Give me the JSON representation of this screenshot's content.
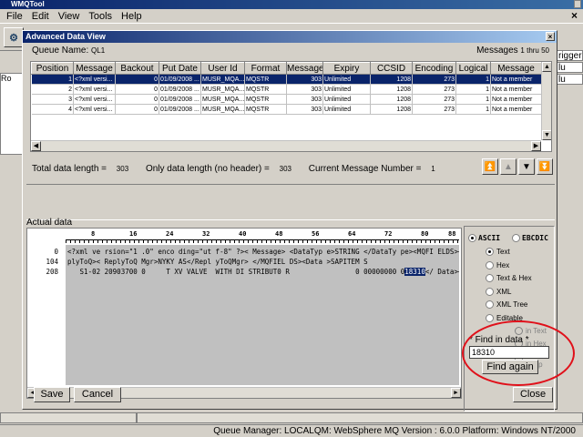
{
  "app": {
    "title": "WMQTool",
    "menu": [
      "File",
      "Edit",
      "View",
      "Tools",
      "Help"
    ]
  },
  "background": {
    "tree_label": "Ro",
    "right_labels": [
      "rigger",
      "lu",
      "lu"
    ],
    "status": "Queue Manager: LOCALQM: WebSphere MQ Version : 6.0.0 Platform: Windows NT/2000"
  },
  "dialog": {
    "title": "Advanced Data View",
    "queue_label": "Queue Name:",
    "queue_name": "QL1",
    "messages_label": "Messages",
    "messages_range": "1 thru 50"
  },
  "grid": {
    "columns": [
      "Position",
      "Message",
      "Backout",
      "Put Date",
      "User Id",
      "Format",
      "Message",
      "Expiry",
      "CCSID",
      "Encoding",
      "Logical",
      "Message"
    ],
    "rows": [
      [
        "1",
        "<?xml versi...",
        "0",
        "01/09/2008 ...",
        "MUSR_MQA...",
        "MQSTR",
        "303",
        "Unlimited",
        "1208",
        "273",
        "1",
        "Not a member"
      ],
      [
        "2",
        "<?xml versi...",
        "0",
        "01/09/2008 ...",
        "MUSR_MQA...",
        "MQSTR",
        "303",
        "Unlimited",
        "1208",
        "273",
        "1",
        "Not a member"
      ],
      [
        "3",
        "<?xml versi...",
        "0",
        "01/09/2008 ...",
        "MUSR_MQA...",
        "MQSTR",
        "303",
        "Unlimited",
        "1208",
        "273",
        "1",
        "Not a member"
      ],
      [
        "4",
        "<?xml versi...",
        "0",
        "01/09/2008 ...",
        "MUSR_MQA...",
        "MQSTR",
        "303",
        "Unlimited",
        "1208",
        "273",
        "1",
        "Not a member"
      ]
    ],
    "selected_row": 0
  },
  "totals": {
    "total_label": "Total data length =",
    "total_value": "303",
    "only_label": "Only data length (no header) =",
    "only_value": "303",
    "current_label": "Current Message Number =",
    "current_value": "1"
  },
  "nav_icons": [
    "first-icon",
    "prev-icon",
    "next-icon",
    "last-icon"
  ],
  "actual_data": {
    "label": "Actual data",
    "ruler": [
      "8",
      "16",
      "24",
      "32",
      "40",
      "48",
      "56",
      "64",
      "72",
      "80",
      "88"
    ],
    "offsets": [
      "0",
      "104",
      "208"
    ],
    "lines": [
      "<?xml ve rsion=\"1 .0\" enco ding=\"ut f-8\" ?>< Message> <DataTyp e>STRING </DataTy pe><MQFI ELDS><Re",
      "plyToQ>< ReplyToQ Mgr>NYKY AS</Repl yToQMgr> </MQFIEL DS><Data >SAPITEM S",
      "   S1-02 20903700 0     T XV VALVE  WITH DI STRIBUT0 R                0 00000000 0"
    ],
    "line3_hit": "18310",
    "line3_tail": "</ Data></M"
  },
  "options": {
    "ascii": "ASCII",
    "ebcdic": "EBCDIC",
    "views": [
      "Text",
      "Hex",
      "Text & Hex",
      "XML",
      "XML Tree",
      "Editable"
    ],
    "selected_view": "Text",
    "in_text": "in Text",
    "in_hex": "in Hex",
    "line_wrap": "Line Wrap",
    "find_label": "* Find in data *",
    "find_value": "18310",
    "find_again": "Find again"
  },
  "buttons": {
    "save": "Save",
    "cancel": "Cancel",
    "close": "Close"
  },
  "colors": {
    "selection": "#0a246a",
    "highlight_circle": "#e0101a"
  }
}
